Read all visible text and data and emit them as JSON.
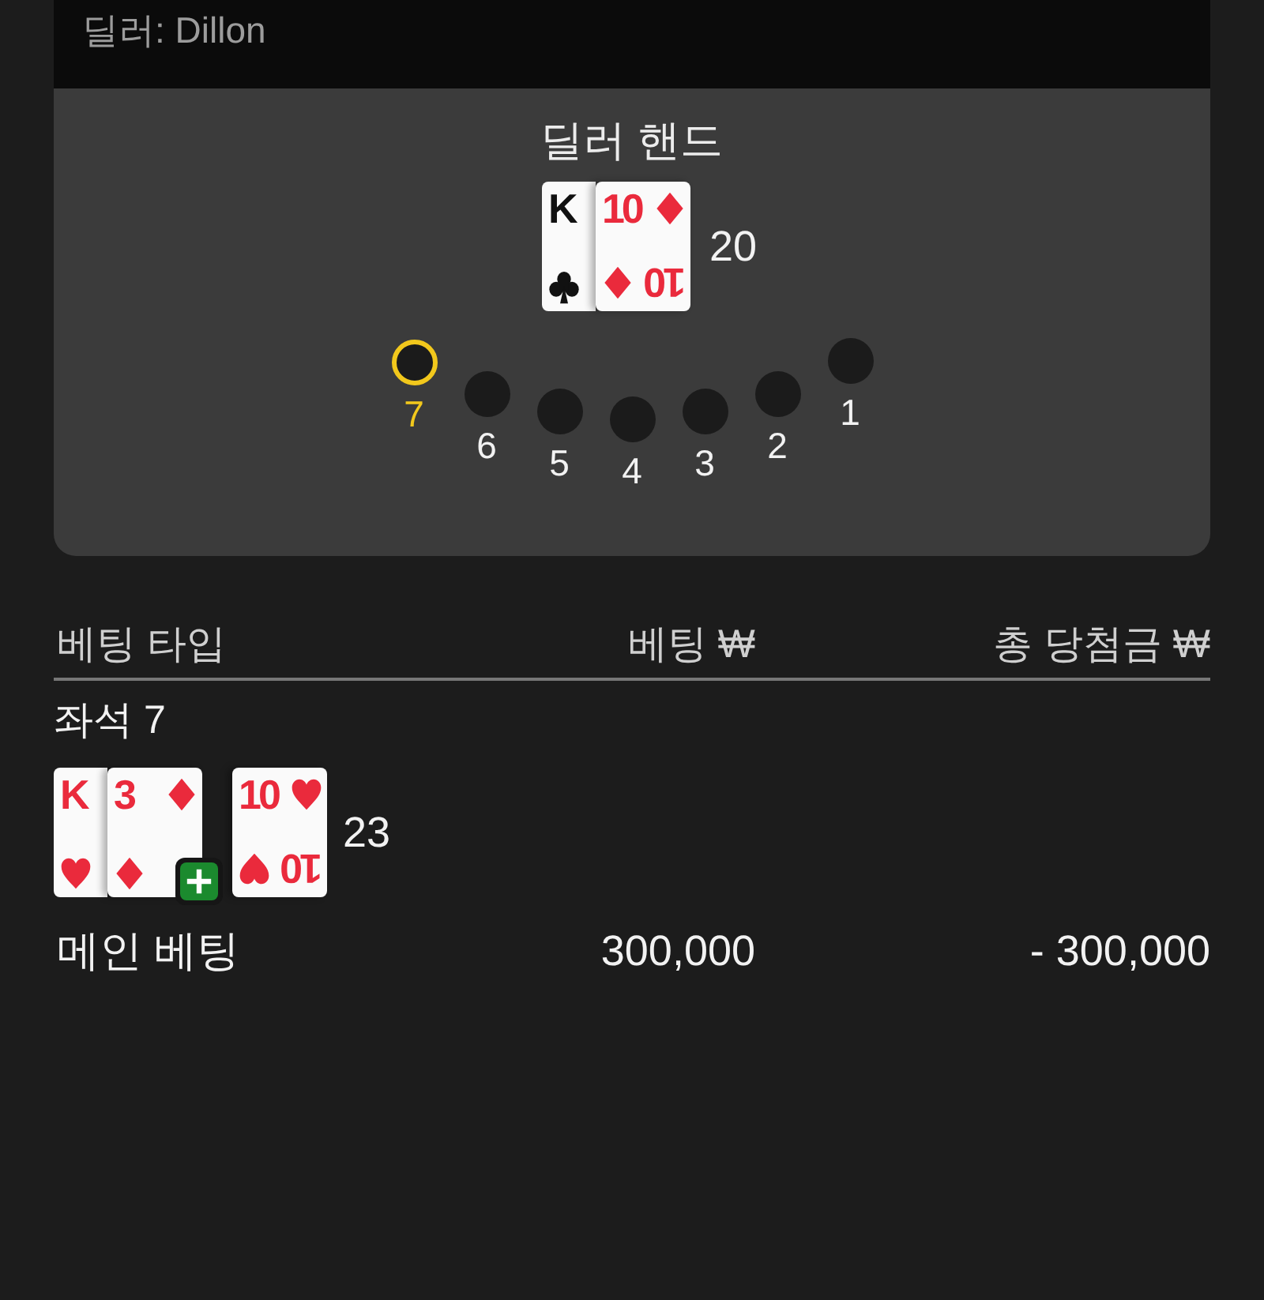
{
  "dealer": {
    "label": "딜러: Dillon"
  },
  "table": {
    "title": "딜러 핸드",
    "cards": [
      {
        "kind": "clubs",
        "ranks": [
          "K"
        ]
      },
      {
        "kind": "diamonds",
        "ranks": [
          "10",
          "10"
        ]
      }
    ],
    "total": "20",
    "seats": [
      {
        "number": "7",
        "selected": true
      },
      {
        "number": "6",
        "selected": false
      },
      {
        "number": "5",
        "selected": false
      },
      {
        "number": "4",
        "selected": false
      },
      {
        "number": "3",
        "selected": false
      },
      {
        "number": "2",
        "selected": false
      },
      {
        "number": "1",
        "selected": false
      }
    ]
  },
  "bets": {
    "columns": [
      "베팅 타입",
      "베팅 ₩",
      "총 당첨금 ₩"
    ],
    "seat_label": "좌석 7",
    "hand": {
      "cards": [
        {
          "kind": "hearts",
          "ranks": [
            "K"
          ]
        },
        {
          "kind": "diamonds",
          "ranks": [
            "3"
          ]
        }
      ],
      "double_down": true,
      "double_card": {
        "kind": "hearts",
        "ranks": [
          "10",
          "10"
        ]
      },
      "total": "23"
    },
    "rows": [
      {
        "type": "메인 베팅",
        "bet": "300,000",
        "payout": "- 300,000"
      }
    ]
  }
}
